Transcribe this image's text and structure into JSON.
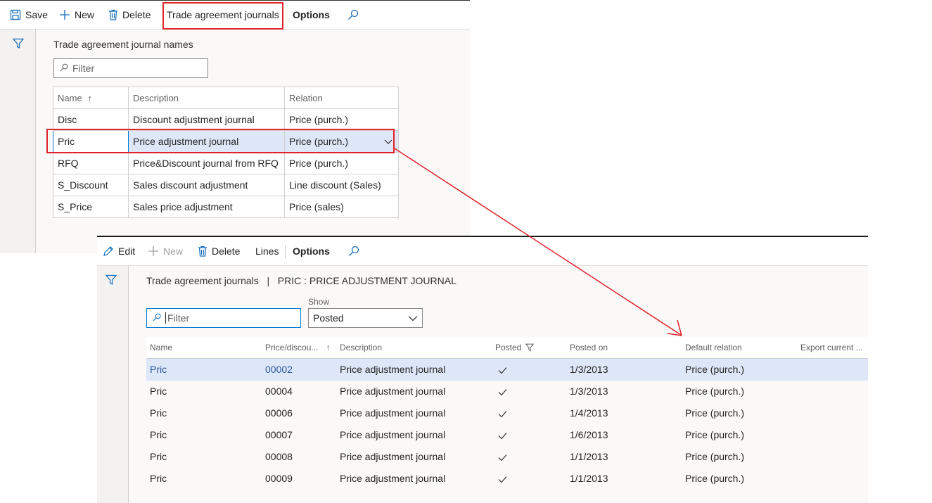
{
  "panel1": {
    "toolbar": {
      "save": "Save",
      "new": "New",
      "delete": "Delete",
      "trade_agreement_journals": "Trade agreement journals",
      "options": "Options"
    },
    "title": "Trade agreement journal names",
    "filter_placeholder": "Filter",
    "columns": {
      "name": "Name",
      "description": "Description",
      "relation": "Relation"
    },
    "rows": [
      {
        "name": "Disc",
        "description": "Discount adjustment journal",
        "relation": "Price (purch.)"
      },
      {
        "name": "Pric",
        "description": "Price adjustment journal",
        "relation": "Price (purch.)"
      },
      {
        "name": "RFQ",
        "description": "Price&Discount journal from RFQ",
        "relation": "Price (purch.)"
      },
      {
        "name": "S_Discount",
        "description": "Sales discount adjustment",
        "relation": "Line discount (Sales)"
      },
      {
        "name": "S_Price",
        "description": "Sales price adjustment",
        "relation": "Price (sales)"
      }
    ],
    "selected_row": 1
  },
  "panel2": {
    "toolbar": {
      "edit": "Edit",
      "new": "New",
      "delete": "Delete",
      "lines": "Lines",
      "options": "Options"
    },
    "breadcrumb": "Trade agreement journals   |   PRIC : PRICE ADJUSTMENT JOURNAL",
    "filter_placeholder": "Filter",
    "show_label": "Show",
    "show_value": "Posted",
    "columns": {
      "name": "Name",
      "price_discount": "Price/discou...",
      "description": "Description",
      "posted": "Posted",
      "posted_on": "Posted on",
      "default_relation": "Default relation",
      "export_current": "Export current ..."
    },
    "rows": [
      {
        "name": "Pric",
        "number": "00002",
        "description": "Price adjustment journal",
        "posted": true,
        "posted_on": "1/3/2013",
        "default_relation": "Price (purch.)"
      },
      {
        "name": "Pric",
        "number": "00004",
        "description": "Price adjustment journal",
        "posted": true,
        "posted_on": "1/3/2013",
        "default_relation": "Price (purch.)"
      },
      {
        "name": "Pric",
        "number": "00006",
        "description": "Price adjustment journal",
        "posted": true,
        "posted_on": "1/4/2013",
        "default_relation": "Price (purch.)"
      },
      {
        "name": "Pric",
        "number": "00007",
        "description": "Price adjustment journal",
        "posted": true,
        "posted_on": "1/6/2013",
        "default_relation": "Price (purch.)"
      },
      {
        "name": "Pric",
        "number": "00008",
        "description": "Price adjustment journal",
        "posted": true,
        "posted_on": "1/1/2013",
        "default_relation": "Price (purch.)"
      },
      {
        "name": "Pric",
        "number": "00009",
        "description": "Price adjustment journal",
        "posted": true,
        "posted_on": "1/1/2013",
        "default_relation": "Price (purch.)"
      }
    ],
    "selected_row": 0
  },
  "colors": {
    "highlight_red": "#e0232b",
    "accent_blue": "#0078d4",
    "selected_row": "#dde7f8"
  }
}
